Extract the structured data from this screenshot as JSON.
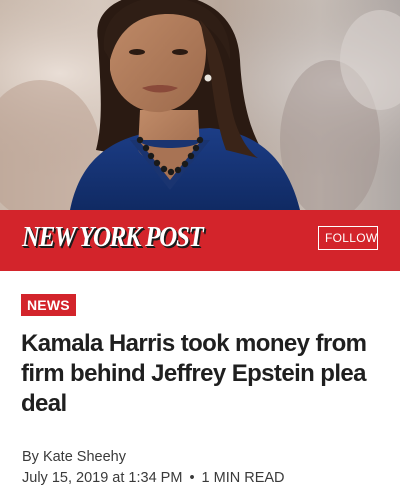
{
  "publication": {
    "name": "NEW YORK POST",
    "follow_label": "FOLLOW",
    "brand_color": "#d3242b"
  },
  "hero_image": {
    "description_icon": "portrait-photo"
  },
  "article": {
    "category": "NEWS",
    "headline": "Kamala Harris took money from firm behind Jeffrey Epstein plea deal",
    "byline": "By Kate Sheehy",
    "date": "July 15, 2019 at 1:34 PM",
    "separator": "•",
    "read_time": "1 MIN READ"
  }
}
